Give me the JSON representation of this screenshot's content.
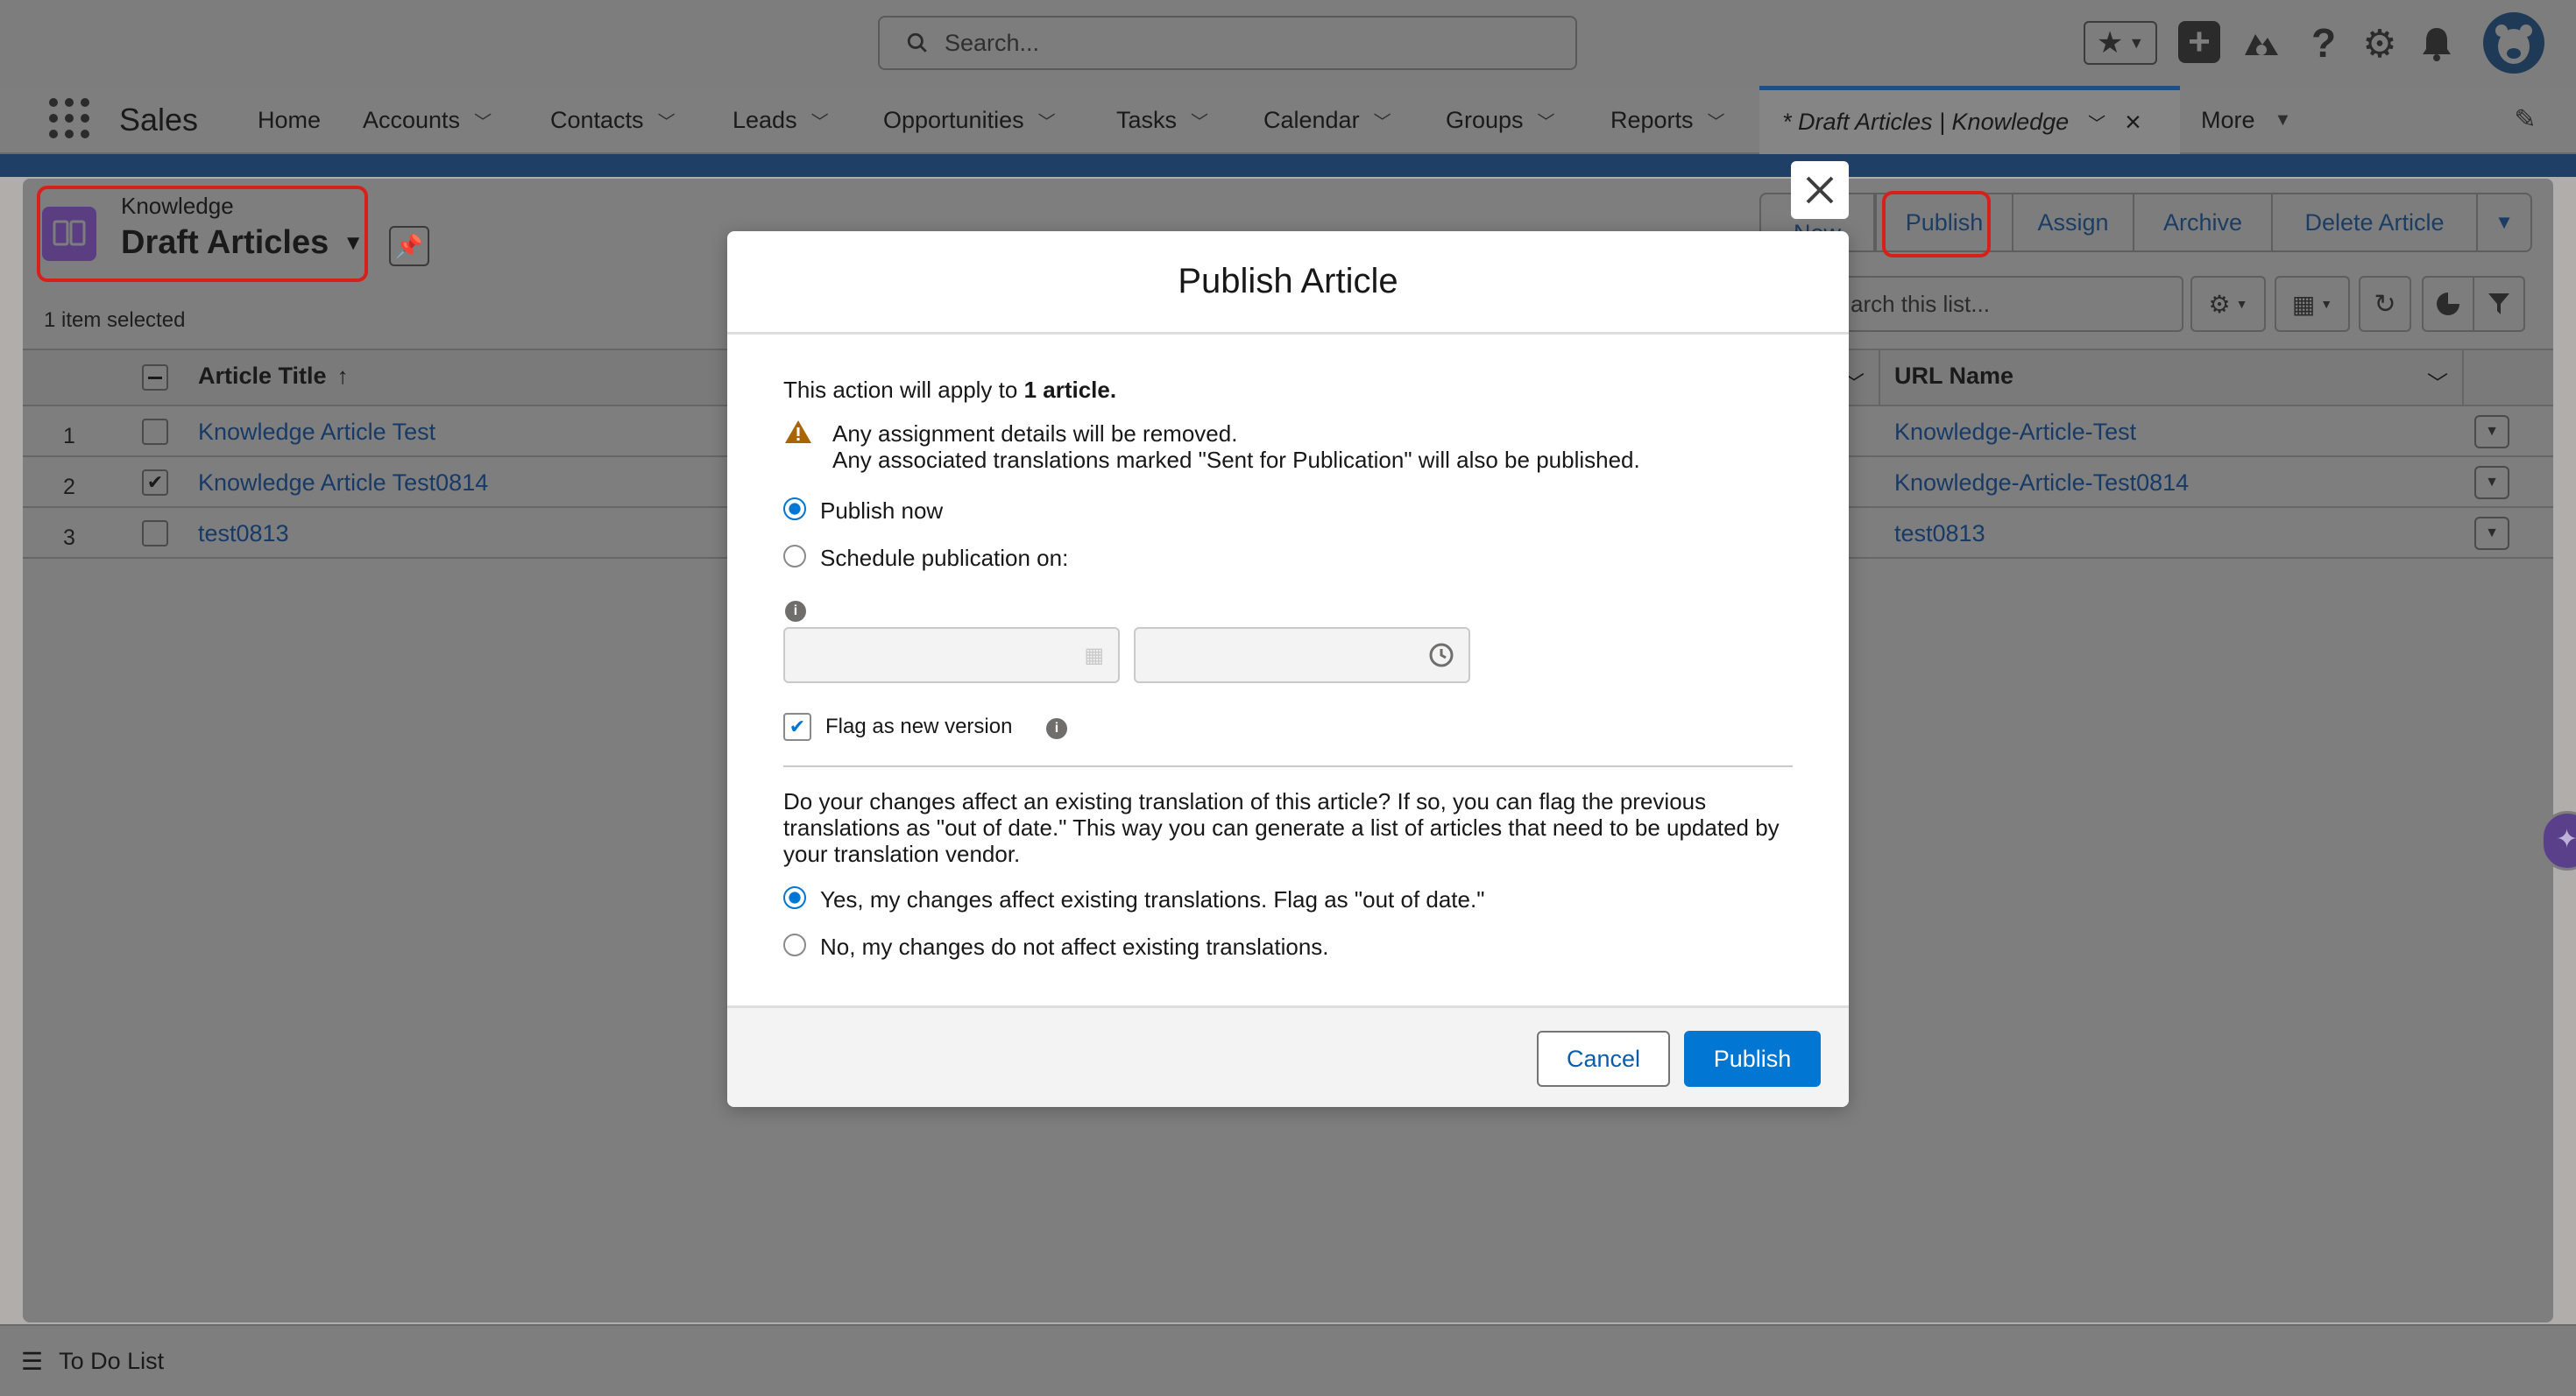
{
  "header": {
    "search_placeholder": "Search...",
    "icons": [
      "star-icon",
      "add-icon",
      "trailhead-icon",
      "help-icon",
      "gear-icon",
      "bell-icon",
      "avatar"
    ]
  },
  "nav": {
    "app_name": "Sales",
    "items": [
      {
        "label": "Home",
        "has_menu": false
      },
      {
        "label": "Accounts",
        "has_menu": true
      },
      {
        "label": "Contacts",
        "has_menu": true
      },
      {
        "label": "Leads",
        "has_menu": true
      },
      {
        "label": "Opportunities",
        "has_menu": true
      },
      {
        "label": "Tasks",
        "has_menu": true
      },
      {
        "label": "Calendar",
        "has_menu": true
      },
      {
        "label": "Groups",
        "has_menu": true
      },
      {
        "label": "Reports",
        "has_menu": true
      }
    ],
    "active_tab": "* Draft Articles | Knowledge",
    "more": "More"
  },
  "list": {
    "object_label": "Knowledge",
    "view_name": "Draft Articles",
    "selection_status": "1 item selected",
    "actions": [
      "New",
      "Publish",
      "Assign",
      "Archive",
      "Delete Article"
    ],
    "search_placeholder": "arch this list...",
    "columns": {
      "title": "Article Title",
      "url": "URL Name"
    },
    "rows": [
      {
        "num": "1",
        "checked": false,
        "title": "Knowledge Article Test",
        "url": "Knowledge-Article-Test"
      },
      {
        "num": "2",
        "checked": true,
        "title": "Knowledge Article Test0814",
        "url": "Knowledge-Article-Test0814"
      },
      {
        "num": "3",
        "checked": false,
        "title": "test0813",
        "url": "test0813"
      }
    ]
  },
  "modal": {
    "title": "Publish Article",
    "apply_prefix": "This action will apply to ",
    "apply_count": "1 article.",
    "warning_line1": "Any assignment details will be removed.",
    "warning_line2": "Any associated translations marked \"Sent for Publication\" will also be published.",
    "publish_now": "Publish now",
    "schedule": "Schedule publication on:",
    "publish_option": "now",
    "flag_new_version": "Flag as new version",
    "flag_checked": true,
    "translation_question": "Do your changes affect an existing translation of this article? If so, you can flag the previous translations as \"out of date.\" This way you can generate a list of articles that need to be updated by your translation vendor.",
    "yes_option": "Yes, my changes affect existing translations. Flag as \"out of date.\"",
    "no_option": "No, my changes do not affect existing translations.",
    "translation_option": "yes",
    "cancel": "Cancel",
    "publish": "Publish"
  },
  "footer": {
    "todo": "To Do List"
  }
}
